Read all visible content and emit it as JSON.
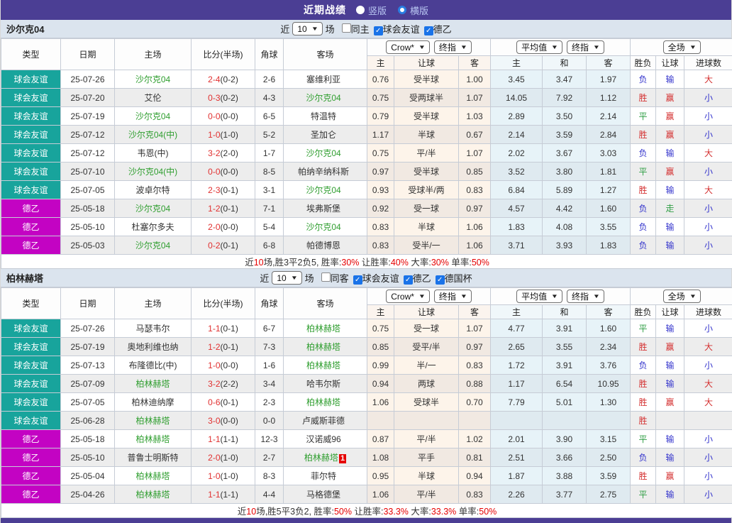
{
  "title_bar": {
    "title": "近期战绩",
    "radios": [
      {
        "label": "竖版",
        "selected": false
      },
      {
        "label": "横版",
        "selected": true
      }
    ]
  },
  "colors": {
    "accent_purple": "#4b3e94",
    "badge_friendly": "#18a49c",
    "badge_league2": "#c303c3",
    "team_green": "#2f9e2f",
    "score_red": "#e03030",
    "summary_red": "#e60000",
    "text_map": {
      "胜": "#d43030",
      "负": "#3333cc",
      "平": "#2f9e44",
      "赢": "#d43030",
      "输": "#3333cc",
      "走": "#2f9e44",
      "大": "#d43030",
      "小": "#3333cc"
    }
  },
  "table_header": {
    "type": "类型",
    "date": "日期",
    "home": "主场",
    "score": "比分(半场)",
    "corner": "角球",
    "away": "客场",
    "crow_select": "Crow*",
    "crow_final_select": "终指",
    "avg_select": "平均值",
    "avg_final_select": "终指",
    "scope_select": "全场",
    "sub": {
      "crow_home": "主",
      "crow_handicap": "让球",
      "crow_away": "客",
      "avg_home": "主",
      "avg_draw": "和",
      "avg_away": "客",
      "result": "胜负",
      "handicap": "让球",
      "goals": "进球数"
    }
  },
  "sections": [
    {
      "team": "沙尔克04",
      "filter": {
        "near_label": "近",
        "count": "10",
        "matches_label": "场",
        "checkboxes": [
          {
            "label": "同主",
            "checked": false
          },
          {
            "label": "球会友谊",
            "checked": true
          },
          {
            "label": "德乙",
            "checked": true
          }
        ]
      },
      "rows": [
        {
          "type": "球会友谊",
          "type_key": "friendly",
          "date": "25-07-26",
          "home": "沙尔克04",
          "home_green": true,
          "score": "2-4",
          "half": "(0-2)",
          "corner": "2-6",
          "away": "塞维利亚",
          "away_green": false,
          "crow_home": "0.76",
          "handicap": "受半球",
          "crow_away": "1.00",
          "avg_home": "3.45",
          "avg_draw": "3.47",
          "avg_away": "1.97",
          "result": "负",
          "handicap_result": "输",
          "goals": "大"
        },
        {
          "type": "球会友谊",
          "type_key": "friendly",
          "date": "25-07-20",
          "home": "艾伦",
          "home_green": false,
          "score": "0-3",
          "half": "(0-2)",
          "corner": "4-3",
          "away": "沙尔克04",
          "away_green": true,
          "crow_home": "0.75",
          "handicap": "受两球半",
          "crow_away": "1.07",
          "avg_home": "14.05",
          "avg_draw": "7.92",
          "avg_away": "1.12",
          "result": "胜",
          "handicap_result": "赢",
          "goals": "小"
        },
        {
          "type": "球会友谊",
          "type_key": "friendly",
          "date": "25-07-19",
          "home": "沙尔克04",
          "home_green": true,
          "score": "0-0",
          "half": "(0-0)",
          "corner": "6-5",
          "away": "特温特",
          "away_green": false,
          "crow_home": "0.79",
          "handicap": "受半球",
          "crow_away": "1.03",
          "avg_home": "2.89",
          "avg_draw": "3.50",
          "avg_away": "2.14",
          "result": "平",
          "handicap_result": "赢",
          "goals": "小"
        },
        {
          "type": "球会友谊",
          "type_key": "friendly",
          "date": "25-07-12",
          "home": "沙尔克04(中)",
          "home_green": true,
          "score": "1-0",
          "half": "(1-0)",
          "corner": "5-2",
          "away": "圣加仑",
          "away_green": false,
          "crow_home": "1.17",
          "handicap": "半球",
          "crow_away": "0.67",
          "avg_home": "2.14",
          "avg_draw": "3.59",
          "avg_away": "2.84",
          "result": "胜",
          "handicap_result": "赢",
          "goals": "小"
        },
        {
          "type": "球会友谊",
          "type_key": "friendly",
          "date": "25-07-12",
          "home": "韦恩(中)",
          "home_green": false,
          "score": "3-2",
          "half": "(2-0)",
          "corner": "1-7",
          "away": "沙尔克04",
          "away_green": true,
          "crow_home": "0.75",
          "handicap": "平/半",
          "crow_away": "1.07",
          "avg_home": "2.02",
          "avg_draw": "3.67",
          "avg_away": "3.03",
          "result": "负",
          "handicap_result": "输",
          "goals": "大"
        },
        {
          "type": "球会友谊",
          "type_key": "friendly",
          "date": "25-07-10",
          "home": "沙尔克04(中)",
          "home_green": true,
          "score": "0-0",
          "half": "(0-0)",
          "corner": "8-5",
          "away": "帕纳辛纳科斯",
          "away_green": false,
          "crow_home": "0.97",
          "handicap": "受半球",
          "crow_away": "0.85",
          "avg_home": "3.52",
          "avg_draw": "3.80",
          "avg_away": "1.81",
          "result": "平",
          "handicap_result": "赢",
          "goals": "小"
        },
        {
          "type": "球会友谊",
          "type_key": "friendly",
          "date": "25-07-05",
          "home": "波卓尔特",
          "home_green": false,
          "score": "2-3",
          "half": "(0-1)",
          "corner": "3-1",
          "away": "沙尔克04",
          "away_green": true,
          "crow_home": "0.93",
          "handicap": "受球半/两",
          "crow_away": "0.83",
          "avg_home": "6.84",
          "avg_draw": "5.89",
          "avg_away": "1.27",
          "result": "胜",
          "handicap_result": "输",
          "goals": "大"
        },
        {
          "type": "德乙",
          "type_key": "league2",
          "date": "25-05-18",
          "home": "沙尔克04",
          "home_green": true,
          "score": "1-2",
          "half": "(0-1)",
          "corner": "7-1",
          "away": "埃弗斯堡",
          "away_green": false,
          "crow_home": "0.92",
          "handicap": "受一球",
          "crow_away": "0.97",
          "avg_home": "4.57",
          "avg_draw": "4.42",
          "avg_away": "1.60",
          "result": "负",
          "handicap_result": "走",
          "goals": "小"
        },
        {
          "type": "德乙",
          "type_key": "league2",
          "date": "25-05-10",
          "home": "杜塞尔多夫",
          "home_green": false,
          "score": "2-0",
          "half": "(0-0)",
          "corner": "5-4",
          "away": "沙尔克04",
          "away_green": true,
          "crow_home": "0.83",
          "handicap": "半球",
          "crow_away": "1.06",
          "avg_home": "1.83",
          "avg_draw": "4.08",
          "avg_away": "3.55",
          "result": "负",
          "handicap_result": "输",
          "goals": "小"
        },
        {
          "type": "德乙",
          "type_key": "league2",
          "date": "25-05-03",
          "home": "沙尔克04",
          "home_green": true,
          "score": "0-2",
          "half": "(0-1)",
          "corner": "6-8",
          "away": "帕德博恩",
          "away_green": false,
          "crow_home": "0.83",
          "handicap": "受半/一",
          "crow_away": "1.06",
          "avg_home": "3.71",
          "avg_draw": "3.93",
          "avg_away": "1.83",
          "result": "负",
          "handicap_result": "输",
          "goals": "小"
        }
      ],
      "summary": [
        {
          "t": "近",
          "red": false
        },
        {
          "t": "10",
          "red": true
        },
        {
          "t": "场,胜3平2负5, 胜率:",
          "red": false
        },
        {
          "t": "30%",
          "red": true
        },
        {
          "t": " 让胜率:",
          "red": false
        },
        {
          "t": "40%",
          "red": true
        },
        {
          "t": " 大率:",
          "red": false
        },
        {
          "t": "30%",
          "red": true
        },
        {
          "t": " 单率:",
          "red": false
        },
        {
          "t": "50%",
          "red": true
        }
      ]
    },
    {
      "team": "柏林赫塔",
      "filter": {
        "near_label": "近",
        "count": "10",
        "matches_label": "场",
        "checkboxes": [
          {
            "label": "同客",
            "checked": false
          },
          {
            "label": "球会友谊",
            "checked": true
          },
          {
            "label": "德乙",
            "checked": true
          },
          {
            "label": "德国杯",
            "checked": true
          }
        ]
      },
      "rows": [
        {
          "type": "球会友谊",
          "type_key": "friendly",
          "date": "25-07-26",
          "home": "马瑟韦尔",
          "home_green": false,
          "score": "1-1",
          "half": "(0-1)",
          "corner": "6-7",
          "away": "柏林赫塔",
          "away_green": true,
          "crow_home": "0.75",
          "handicap": "受一球",
          "crow_away": "1.07",
          "avg_home": "4.77",
          "avg_draw": "3.91",
          "avg_away": "1.60",
          "result": "平",
          "handicap_result": "输",
          "goals": "小"
        },
        {
          "type": "球会友谊",
          "type_key": "friendly",
          "date": "25-07-19",
          "home": "奥地利维也纳",
          "home_green": false,
          "score": "1-2",
          "half": "(0-1)",
          "corner": "7-3",
          "away": "柏林赫塔",
          "away_green": true,
          "crow_home": "0.85",
          "handicap": "受平/半",
          "crow_away": "0.97",
          "avg_home": "2.65",
          "avg_draw": "3.55",
          "avg_away": "2.34",
          "result": "胜",
          "handicap_result": "赢",
          "goals": "大"
        },
        {
          "type": "球会友谊",
          "type_key": "friendly",
          "date": "25-07-13",
          "home": "布隆德比(中)",
          "home_green": false,
          "score": "1-0",
          "half": "(0-0)",
          "corner": "1-6",
          "away": "柏林赫塔",
          "away_green": true,
          "crow_home": "0.99",
          "handicap": "半/一",
          "crow_away": "0.83",
          "avg_home": "1.72",
          "avg_draw": "3.91",
          "avg_away": "3.76",
          "result": "负",
          "handicap_result": "输",
          "goals": "小"
        },
        {
          "type": "球会友谊",
          "type_key": "friendly",
          "date": "25-07-09",
          "home": "柏林赫塔",
          "home_green": true,
          "score": "3-2",
          "half": "(2-2)",
          "corner": "3-4",
          "away": "哈韦尔斯",
          "away_green": false,
          "crow_home": "0.94",
          "handicap": "两球",
          "crow_away": "0.88",
          "avg_home": "1.17",
          "avg_draw": "6.54",
          "avg_away": "10.95",
          "result": "胜",
          "handicap_result": "输",
          "goals": "大"
        },
        {
          "type": "球会友谊",
          "type_key": "friendly",
          "date": "25-07-05",
          "home": "柏林迪纳摩",
          "home_green": false,
          "score": "0-6",
          "half": "(0-1)",
          "corner": "2-3",
          "away": "柏林赫塔",
          "away_green": true,
          "crow_home": "1.06",
          "handicap": "受球半",
          "crow_away": "0.70",
          "avg_home": "7.79",
          "avg_draw": "5.01",
          "avg_away": "1.30",
          "result": "胜",
          "handicap_result": "赢",
          "goals": "大"
        },
        {
          "type": "球会友谊",
          "type_key": "friendly",
          "date": "25-06-28",
          "home": "柏林赫塔",
          "home_green": true,
          "score": "3-0",
          "half": "(0-0)",
          "corner": "0-0",
          "away": "卢威斯菲德",
          "away_green": false,
          "crow_home": "",
          "handicap": "",
          "crow_away": "",
          "avg_home": "",
          "avg_draw": "",
          "avg_away": "",
          "result": "胜",
          "handicap_result": "",
          "goals": ""
        },
        {
          "type": "德乙",
          "type_key": "league2",
          "date": "25-05-18",
          "home": "柏林赫塔",
          "home_green": true,
          "score": "1-1",
          "half": "(1-1)",
          "corner": "12-3",
          "away": "汉诺威96",
          "away_green": false,
          "crow_home": "0.87",
          "handicap": "平/半",
          "crow_away": "1.02",
          "avg_home": "2.01",
          "avg_draw": "3.90",
          "avg_away": "3.15",
          "result": "平",
          "handicap_result": "输",
          "goals": "小"
        },
        {
          "type": "德乙",
          "type_key": "league2",
          "date": "25-05-10",
          "home": "普鲁士明斯特",
          "home_green": false,
          "score": "2-0",
          "half": "(1-0)",
          "corner": "2-7",
          "away": "柏林赫塔",
          "away_green": true,
          "away_badge": "1",
          "crow_home": "1.08",
          "handicap": "平手",
          "crow_away": "0.81",
          "avg_home": "2.51",
          "avg_draw": "3.66",
          "avg_away": "2.50",
          "result": "负",
          "handicap_result": "输",
          "goals": "小"
        },
        {
          "type": "德乙",
          "type_key": "league2",
          "date": "25-05-04",
          "home": "柏林赫塔",
          "home_green": true,
          "score": "1-0",
          "half": "(1-0)",
          "corner": "8-3",
          "away": "菲尔特",
          "away_green": false,
          "crow_home": "0.95",
          "handicap": "半球",
          "crow_away": "0.94",
          "avg_home": "1.87",
          "avg_draw": "3.88",
          "avg_away": "3.59",
          "result": "胜",
          "handicap_result": "赢",
          "goals": "小"
        },
        {
          "type": "德乙",
          "type_key": "league2",
          "date": "25-04-26",
          "home": "柏林赫塔",
          "home_green": true,
          "score": "1-1",
          "half": "(1-1)",
          "corner": "4-4",
          "away": "马格德堡",
          "away_green": false,
          "crow_home": "1.06",
          "handicap": "平/半",
          "crow_away": "0.83",
          "avg_home": "2.26",
          "avg_draw": "3.77",
          "avg_away": "2.75",
          "result": "平",
          "handicap_result": "输",
          "goals": "小"
        }
      ],
      "summary": [
        {
          "t": "近",
          "red": false
        },
        {
          "t": "10",
          "red": true
        },
        {
          "t": "场,胜5平3负2, 胜率:",
          "red": false
        },
        {
          "t": "50%",
          "red": true
        },
        {
          "t": " 让胜率:",
          "red": false
        },
        {
          "t": "33.3%",
          "red": true
        },
        {
          "t": " 大率:",
          "red": false
        },
        {
          "t": "33.3%",
          "red": true
        },
        {
          "t": " 单率:",
          "red": false
        },
        {
          "t": "50%",
          "red": true
        }
      ]
    }
  ]
}
